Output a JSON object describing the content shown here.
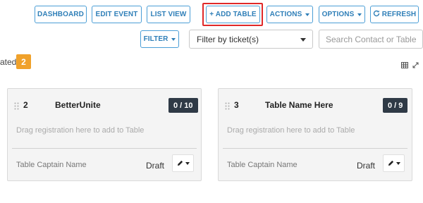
{
  "toolbar": {
    "dashboard": "DASHBOARD",
    "edit_event": "EDIT EVENT",
    "list_view": "LIST VIEW",
    "add_table": "+ ADD TABLE",
    "actions": "ACTIONS",
    "options": "OPTIONS",
    "refresh": "REFRESH"
  },
  "filter_bar": {
    "filter_label": "FILTER",
    "ticket_select_value": "Filter by ticket(s)",
    "search_placeholder": "Search Contact or Table"
  },
  "status": {
    "text": "ated",
    "badge_count": "2"
  },
  "tables": [
    {
      "number": "2",
      "name": "BetterUnite",
      "count": "0 / 10",
      "hint": "Drag registration here to add to Table",
      "captain_label": "Table Captain Name",
      "status": "Draft"
    },
    {
      "number": "3",
      "name": "Table Name Here",
      "count": "0 / 9",
      "hint": "Drag registration here to add to Table",
      "captain_label": "Table Captain Name",
      "status": "Draft"
    }
  ],
  "colors": {
    "accent": "#2f7fb8",
    "highlight": "#e02828",
    "badge": "#f0a12a",
    "count_badge": "#2f3a46"
  }
}
